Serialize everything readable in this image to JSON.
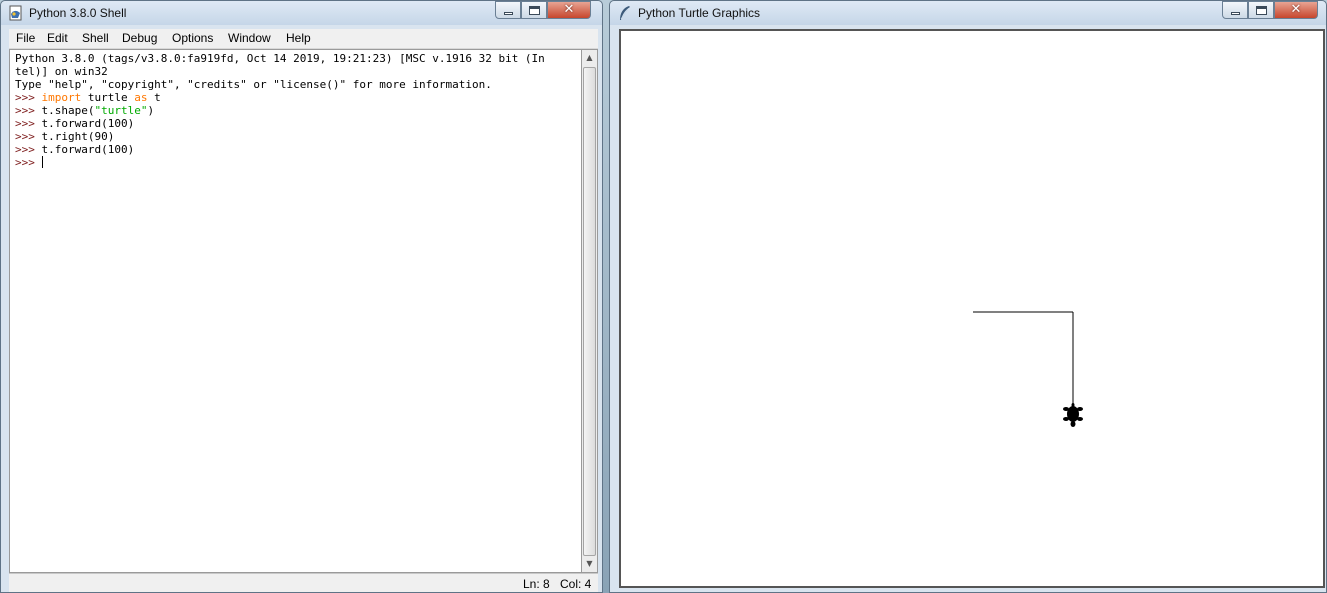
{
  "shell": {
    "title": "Python 3.8.0 Shell",
    "menu": [
      "File",
      "Edit",
      "Shell",
      "Debug",
      "Options",
      "Window",
      "Help"
    ],
    "banner_line1": "Python 3.8.0 (tags/v3.8.0:fa919fd, Oct 14 2019, 19:21:23) [MSC v.1916 32 bit (In",
    "banner_line2": "tel)] on win32",
    "banner_line3": "Type \"help\", \"copyright\", \"credits\" or \"license()\" for more information.",
    "prompt": ">>>",
    "line1": {
      "kw1": "import",
      "mid": " turtle ",
      "kw2": "as",
      "tail": " t"
    },
    "line2": {
      "head": "t.shape(",
      "str": "\"turtle\"",
      "tail": ")"
    },
    "line3": "t.forward(100)",
    "line4": "t.right(90)",
    "line5": "t.forward(100)",
    "status": {
      "ln": "Ln: 8",
      "col": "Col: 4"
    },
    "icons": {
      "app": "idle-icon",
      "minimize": "minimize-icon",
      "maximize": "maximize-icon",
      "close": "close-icon",
      "scroll_up": "arrow-up-icon",
      "scroll_down": "arrow-down-icon"
    }
  },
  "turtle_window": {
    "title": "Python Turtle Graphics",
    "icons": {
      "app": "feather-icon",
      "turtle": "turtle-icon"
    },
    "drawing": {
      "moves": [
        {
          "cmd": "forward",
          "value": 100
        },
        {
          "cmd": "right",
          "value": 90
        },
        {
          "cmd": "forward",
          "value": 100
        }
      ],
      "pen_color": "#000000"
    }
  },
  "colors": {
    "prompt": "#7f1f1f",
    "keyword": "#ff7700",
    "string": "#00aa00"
  }
}
